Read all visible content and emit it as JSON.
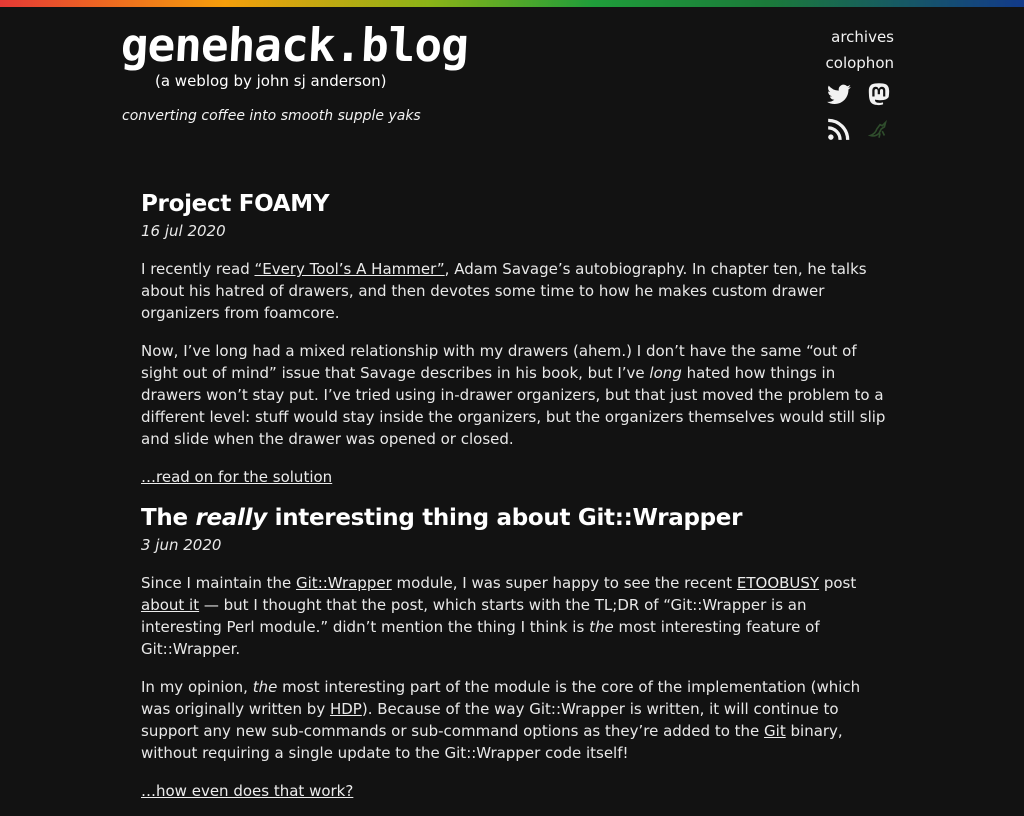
{
  "colors": {
    "background": "#121212",
    "text": "#ececec",
    "date": "#9a9a9a"
  },
  "site": {
    "logo": "genehack.blog",
    "byline": "(a weblog by john sj anderson)",
    "tagline": "converting coffee into smooth supple yaks"
  },
  "nav": {
    "archives": "archives",
    "colophon": "colophon",
    "icons": [
      "twitter-icon",
      "mastodon-icon",
      "rss-icon",
      "bird-icon"
    ]
  },
  "posts": [
    {
      "title": "Project FOAMY",
      "date": "16 jul 2020",
      "p1_a": "I recently read ",
      "p1_link": "“Every Tool’s A Hammer”",
      "p1_b": ", Adam Savage’s autobiography. In chapter ten, he talks about his hatred of drawers, and then devotes some time to how he makes custom drawer organizers from foamcore.",
      "p2_a": "Now, I’ve long had a mixed relationship with my drawers (ahem.) I don’t have the same “out of sight out of mind” issue that Savage describes in his book, but I’ve ",
      "p2_em": "long",
      "p2_b": " hated how things in drawers won’t stay put. I’ve tried using in-drawer organizers, but that just moved the problem to a different level: stuff would stay inside the organizers, but the organizers themselves would still slip and slide when the drawer was opened or closed.",
      "readmore": "…read on for the solution"
    },
    {
      "title_a": "The ",
      "title_em": "really",
      "title_b": " interesting thing about Git::Wrapper",
      "date": "3 jun 2020",
      "p1_a": "Since I maintain the ",
      "p1_link1": "Git::Wrapper",
      "p1_b": " module, I was super happy to see the recent ",
      "p1_link2": "ETOOBUSY",
      "p1_c": " post ",
      "p1_link3": "about it",
      "p1_d": " — but I thought that the post, which starts with the TL;DR of “Git::Wrapper is an interesting Perl module.” didn’t mention the thing I think is ",
      "p1_em": "the",
      "p1_e": " most interesting feature of Git::Wrapper.",
      "p2_a": "In my opinion, ",
      "p2_em": "the",
      "p2_b": " most interesting part of the module is the core of the implementation (which was originally written by ",
      "p2_link1": "HDP",
      "p2_c": "). Because of the way Git::Wrapper is written, it will continue to support any new sub-commands or sub-command options as they’re added to the ",
      "p2_link2": "Git",
      "p2_d": " binary, without requiring a single update to the Git::Wrapper code itself!",
      "readmore": "…how even does that work?"
    }
  ]
}
